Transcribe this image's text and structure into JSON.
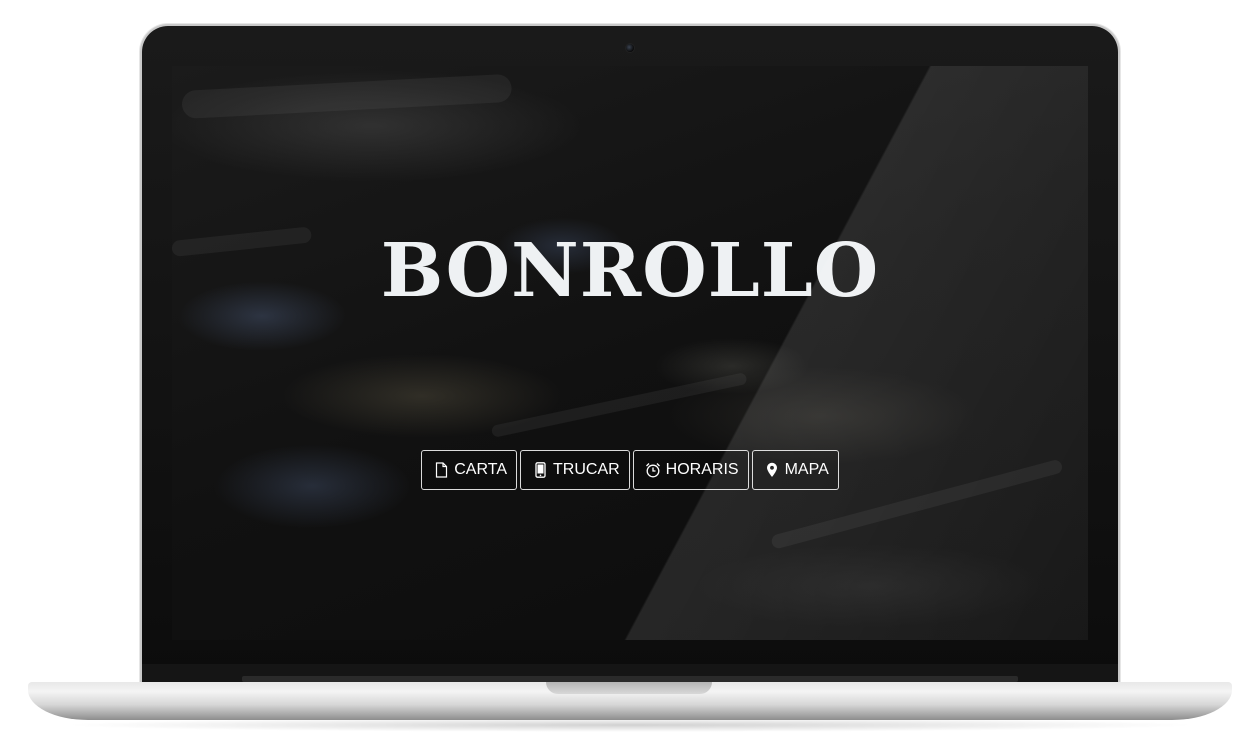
{
  "site": {
    "brand": "BONROLLO"
  },
  "nav": {
    "items": [
      {
        "label": "CARTA",
        "icon": "document-icon"
      },
      {
        "label": "TRUCAR",
        "icon": "mobile-phone-icon"
      },
      {
        "label": "HORARIS",
        "icon": "alarm-clock-icon"
      },
      {
        "label": "MAPA",
        "icon": "map-pin-icon"
      }
    ]
  },
  "colors": {
    "text": "#eef1f3",
    "background": "#0d0d0d",
    "button_border": "#ffffff"
  }
}
